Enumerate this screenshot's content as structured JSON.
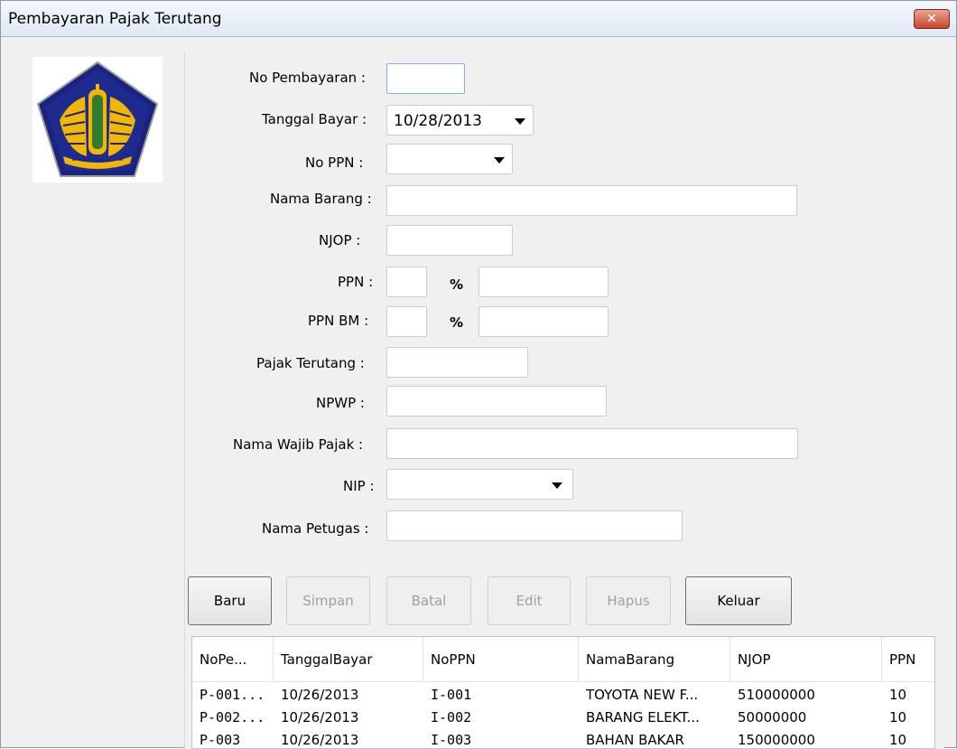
{
  "window": {
    "title": "Pembayaran Pajak Terutang",
    "close_symbol": "✕",
    "logo": "kemenkeu-emblem-icon"
  },
  "form": {
    "no_pembayaran_label": "No Pembayaran :",
    "no_pembayaran_value": "",
    "tanggal_bayar_label": "Tanggal Bayar :",
    "tanggal_bayar_value": "10/28/2013",
    "no_ppn_label": "No PPN :",
    "no_ppn_value": "",
    "nama_barang_label": "Nama Barang :",
    "njop_label": "NJOP :",
    "ppn_label": "PPN :",
    "ppnbm_label": "PPN BM :",
    "percent_symbol": "%",
    "pajak_terutang_label": "Pajak Terutang :",
    "npwp_label": "NPWP :",
    "nama_wajib_pajak_label": "Nama Wajib Pajak :",
    "nip_label": "NIP :",
    "nip_value": "",
    "nama_petugas_label": "Nama Petugas :"
  },
  "buttons": {
    "baru": "Baru",
    "simpan": "Simpan",
    "batal": "Batal",
    "edit": "Edit",
    "hapus": "Hapus",
    "keluar": "Keluar"
  },
  "table": {
    "columns": [
      "NoPe...",
      "TanggalBayar",
      "NoPPN",
      "NamaBarang",
      "NJOP",
      "PPN"
    ],
    "rows": [
      [
        "P-001...",
        "10/26/2013",
        "I-001",
        "TOYOTA NEW F...",
        "510000000",
        "10"
      ],
      [
        "P-002...",
        "10/26/2013",
        "I-002",
        "BARANG ELEKT...",
        "50000000",
        "10"
      ],
      [
        "P-003",
        "10/26/2013",
        "I-003",
        "BAHAN BAKAR",
        "150000000",
        "10"
      ]
    ]
  },
  "colors": {
    "window_bg": "#f0f0f0",
    "close_button": "#c9452c",
    "logo_blue": "#1a237e",
    "logo_gold": "#f2b705"
  }
}
